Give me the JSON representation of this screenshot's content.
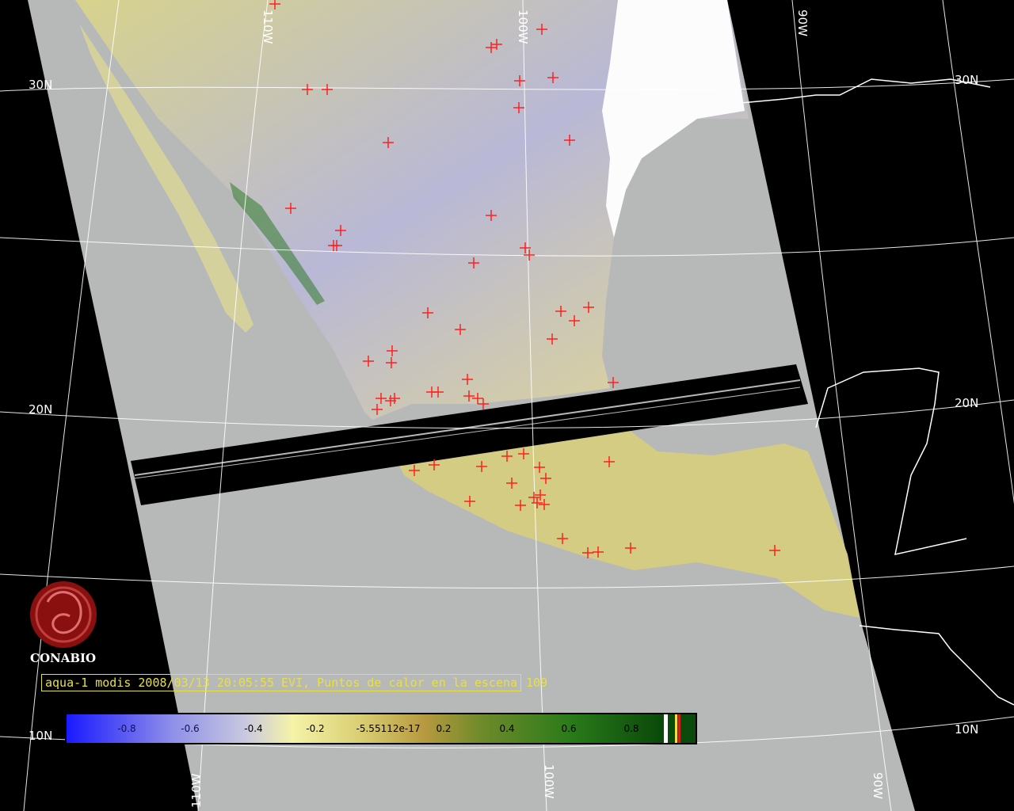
{
  "organization": "CONABIO",
  "caption": {
    "text": "aqua-1 modis 2008/03/13 20:05:55 EVI, Puntos de calor en la escena",
    "count": "109"
  },
  "graticule": {
    "lat_labels": [
      "30N",
      "30N",
      "20N",
      "20N",
      "10N",
      "10N"
    ],
    "lon_labels": [
      "110W",
      "100W",
      "90W",
      "100W",
      "90W",
      "110W"
    ]
  },
  "colorbar": {
    "tick_labels": [
      "-0.8",
      "-0.6",
      "-0.4",
      "-0.2",
      "-5.55112e-17",
      "0.2",
      "0.4",
      "0.6",
      "0.8"
    ],
    "colors": {
      "low": "#1a1aff",
      "mid_low": "#b8b8e8",
      "zero": "#f2f0a0",
      "mid_high": "#b89a40",
      "high": "#0a5a0a"
    }
  },
  "colors": {
    "background": "#000000",
    "swath_fill": "#b7b9b9",
    "hotspot": "#ff2020",
    "grid": "#ffffff",
    "caption": "#e8e040",
    "logo": "#8a1010"
  }
}
